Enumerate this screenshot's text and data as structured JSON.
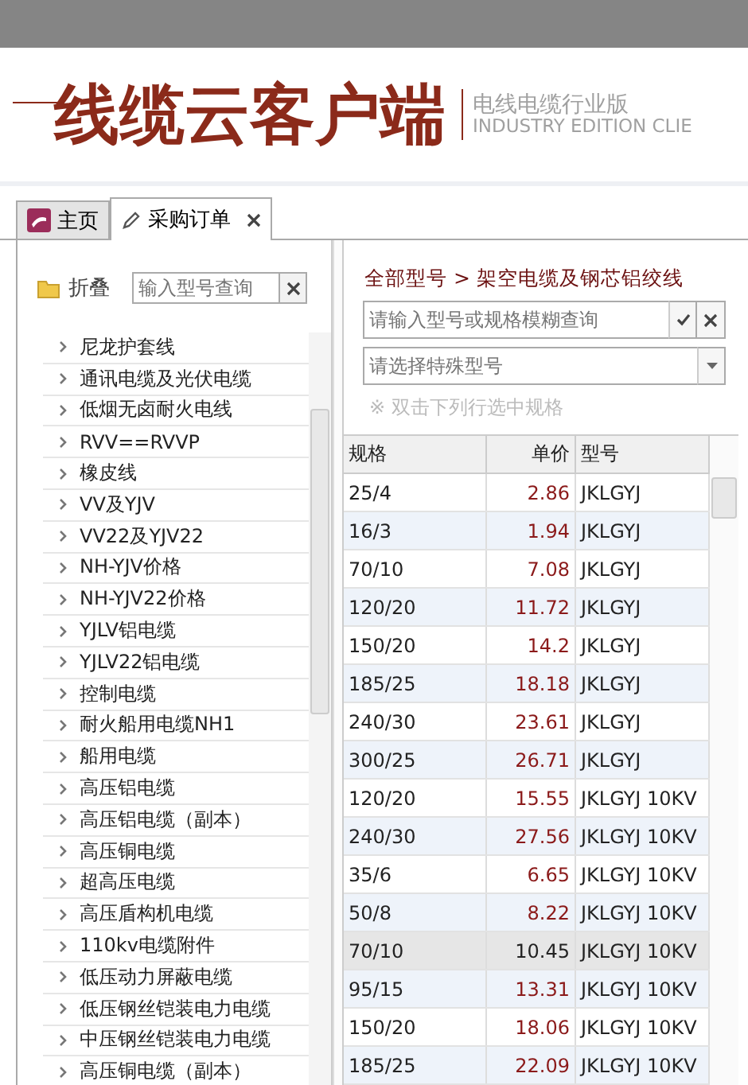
{
  "header": {
    "title": "线缆云客户端",
    "subtitle": "电线电缆行业版",
    "subtitle_en": "INDUSTRY EDITION CLIE"
  },
  "tabs": [
    {
      "label": "主页",
      "kind": "home",
      "selected": false,
      "closable": false
    },
    {
      "label": "采购订单",
      "kind": "edit",
      "selected": true,
      "closable": true
    }
  ],
  "left": {
    "collapse_label": "折叠",
    "search": {
      "placeholder": "输入型号查询"
    },
    "categories": [
      "尼龙护套线",
      "通讯电缆及光伏电缆",
      "低烟无卤耐火电线",
      "RVV==RVVP",
      "橡皮线",
      "VV及YJV",
      "VV22及YJV22",
      "NH-YJV价格",
      "NH-YJV22价格",
      "YJLV铝电缆",
      "YJLV22铝电缆",
      "控制电缆",
      "耐火船用电缆NH1",
      "船用电缆",
      "高压铝电缆",
      "高压铝电缆（副本）",
      "高压铜电缆",
      "超高压电缆",
      "高压盾构机电缆",
      "110kv电缆附件",
      "低压动力屏蔽电缆",
      "低压钢丝铠装电力电缆",
      "中压钢丝铠装电力电缆",
      "高压铜电缆（副本）"
    ]
  },
  "right": {
    "breadcrumb": "全部型号 > 架空电缆及钢芯铝绞线",
    "search": {
      "placeholder": "请输入型号或规格模糊查询"
    },
    "select": {
      "placeholder": "请选择特殊型号"
    },
    "hint": "※ 双击下列行选中规格",
    "table": {
      "columns": [
        "规格",
        "单价",
        "型号"
      ],
      "rows": [
        {
          "spec": "25/4",
          "price": "2.86",
          "model": "JKLGYJ",
          "selected": false
        },
        {
          "spec": "16/3",
          "price": "1.94",
          "model": "JKLGYJ",
          "selected": false
        },
        {
          "spec": "70/10",
          "price": "7.08",
          "model": "JKLGYJ",
          "selected": false
        },
        {
          "spec": "120/20",
          "price": "11.72",
          "model": "JKLGYJ",
          "selected": false
        },
        {
          "spec": "150/20",
          "price": "14.2",
          "model": "JKLGYJ",
          "selected": false
        },
        {
          "spec": "185/25",
          "price": "18.18",
          "model": "JKLGYJ",
          "selected": false
        },
        {
          "spec": "240/30",
          "price": "23.61",
          "model": "JKLGYJ",
          "selected": false
        },
        {
          "spec": "300/25",
          "price": "26.71",
          "model": "JKLGYJ",
          "selected": false
        },
        {
          "spec": "120/20",
          "price": "15.55",
          "model": "JKLGYJ 10KV",
          "selected": false
        },
        {
          "spec": "240/30",
          "price": "27.56",
          "model": "JKLGYJ 10KV",
          "selected": false
        },
        {
          "spec": "35/6",
          "price": "6.65",
          "model": "JKLGYJ 10KV",
          "selected": false
        },
        {
          "spec": "50/8",
          "price": "8.22",
          "model": "JKLGYJ 10KV",
          "selected": false
        },
        {
          "spec": "70/10",
          "price": "10.45",
          "model": "JKLGYJ 10KV",
          "selected": true
        },
        {
          "spec": "95/15",
          "price": "13.31",
          "model": "JKLGYJ 10KV",
          "selected": false
        },
        {
          "spec": "150/20",
          "price": "18.06",
          "model": "JKLGYJ 10KV",
          "selected": false
        },
        {
          "spec": "185/25",
          "price": "22.09",
          "model": "JKLGYJ 10KV",
          "selected": false
        }
      ]
    }
  }
}
